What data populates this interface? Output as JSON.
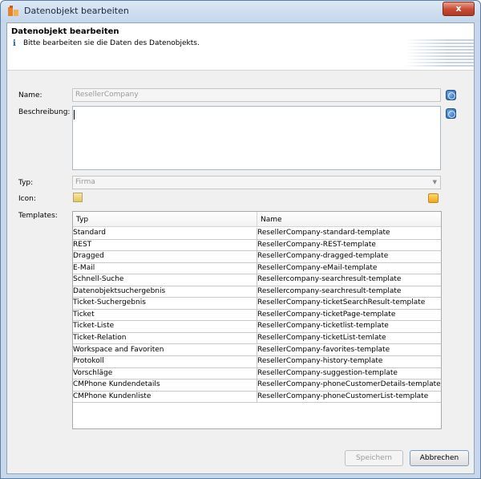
{
  "window": {
    "title": "Datenobjekt bearbeiten",
    "close_label": "x"
  },
  "header": {
    "title": "Datenobjekt bearbeiten",
    "subtitle": "Bitte bearbeiten sie die Daten des Datenobjekts.",
    "info_glyph": "i"
  },
  "form": {
    "name_label": "Name:",
    "name_value": "ResellerCompany",
    "description_label": "Beschreibung:",
    "description_value": "",
    "type_label": "Typ:",
    "type_value": "Firma",
    "icon_label": "Icon:",
    "templates_label": "Templates:"
  },
  "templates": {
    "columns": [
      "Typ",
      "Name"
    ],
    "rows": [
      [
        "Standard",
        "ResellerCompany-standard-template"
      ],
      [
        "REST",
        "ResellerCompany-REST-template"
      ],
      [
        "Dragged",
        "ResellerCompany-dragged-template"
      ],
      [
        "E-Mail",
        "ResellerCompany-eMail-template"
      ],
      [
        "Schnell-Suche",
        "Resellercompany-searchresult-template"
      ],
      [
        "Datenobjektsuchergebnis",
        "Resellercompany-searchresult-template"
      ],
      [
        "Ticket-Suchergebnis",
        "ResellerCompany-ticketSearchResult-template"
      ],
      [
        "Ticket",
        "ResellerCompany-ticketPage-template"
      ],
      [
        "Ticket-Liste",
        "ResellerCompany-ticketlist-template"
      ],
      [
        "Ticket-Relation",
        "ResellerCompany-ticketList-temlate"
      ],
      [
        "Workspace and Favoriten",
        "ResellerCompany-favorites-template"
      ],
      [
        "Protokoll",
        "ResellerCompany-history-template"
      ],
      [
        "Vorschläge",
        "ResellerCompany-suggestion-template"
      ],
      [
        "CMPhone Kundendetails",
        "ResellerCompany-phoneCustomerDetails-template"
      ],
      [
        "CMPhone Kundenliste",
        "ResellerCompany-phoneCustomerList-template"
      ]
    ]
  },
  "buttons": {
    "save": "Speichern",
    "cancel": "Abbrechen"
  },
  "colors": {
    "accent": "#2063b0",
    "titlebar": "#c3d6ea",
    "close": "#c74a32"
  },
  "icons": [
    "app-icon",
    "info-icon",
    "globe-icon",
    "image-icon",
    "folder-icon",
    "dropdown-arrow-icon"
  ]
}
